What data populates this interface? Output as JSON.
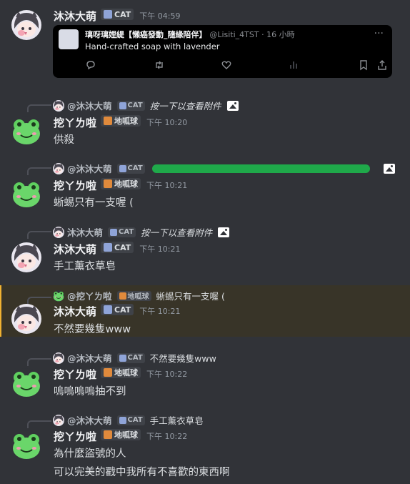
{
  "colors": {
    "background": "#313338",
    "highlight": "#383428",
    "scribble": "#1fa94a"
  },
  "tweet_embed": {
    "title": "璃呀璃娌緹【懶癌發動_隨緣陪伴】",
    "handle": "@Lisiti_4TST · 16 小時",
    "body": "Hand-crafted soap with lavender",
    "more": "···",
    "actions": [
      "reply-icon",
      "retweet-icon",
      "heart-icon",
      "views-icon",
      "bookmark-icon",
      "share-icon"
    ]
  },
  "messages": [
    {
      "author": "沐沐大萌",
      "tag": "CAT",
      "time": "下午 04:59",
      "lines": []
    },
    {
      "reply": {
        "author": "@沐沐大萌",
        "tag": "CAT",
        "text": "按一下以查看附件",
        "italic": true,
        "image_icon": true
      },
      "author": "挖ㄚㄌ啦",
      "tag": "地呱球",
      "time": "下午 10:20",
      "lines": [
        "供殺"
      ]
    },
    {
      "reply": {
        "author": "@沐沐大萌",
        "tag": "CAT",
        "text": "",
        "scribbled": true,
        "image_icon": true
      },
      "author": "挖ㄚㄌ啦",
      "tag": "地呱球",
      "time": "下午 10:21",
      "lines": [
        "蜥蜴只有一支喔 ("
      ]
    },
    {
      "reply": {
        "author": "沐沐大萌",
        "tag": "CAT",
        "text": "按一下以查看附件",
        "italic": true,
        "image_icon": true
      },
      "author": "沐沐大萌",
      "tag": "CAT",
      "time": "下午 10:21",
      "lines": [
        "手工薰衣草皂"
      ]
    },
    {
      "reply": {
        "author": "@挖ㄚㄌ啦",
        "tag": "地呱球",
        "text": "蜥蜴只有一支喔 ("
      },
      "author": "沐沐大萌",
      "tag": "CAT",
      "time": "下午 10:21",
      "lines": [
        "不然要幾隻www"
      ],
      "highlighted": true
    },
    {
      "reply": {
        "author": "@沐沐大萌",
        "tag": "CAT",
        "text": "不然要幾隻www"
      },
      "author": "挖ㄚㄌ啦",
      "tag": "地呱球",
      "time": "下午 10:22",
      "lines": [
        "嗚嗚嗚嗚抽不到"
      ]
    },
    {
      "reply": {
        "author": "@沐沐大萌",
        "tag": "CAT",
        "text": "手工薰衣草皂"
      },
      "author": "挖ㄚㄌ啦",
      "tag": "地呱球",
      "time": "下午 10:22",
      "lines": [
        "為什麼盜號的人",
        "可以完美的戳中我所有不喜歡的東西啊"
      ]
    }
  ]
}
